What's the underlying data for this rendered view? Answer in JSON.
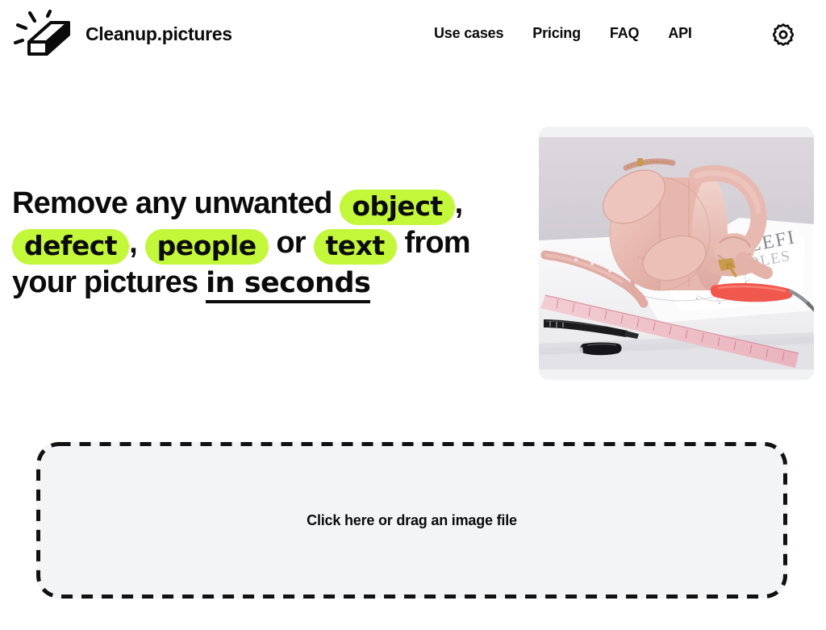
{
  "brand": {
    "name": "Cleanup.pictures",
    "logo_icon": "eraser-sparkle-icon"
  },
  "nav": {
    "items": [
      {
        "label": "Use cases",
        "name": "use-cases"
      },
      {
        "label": "Pricing",
        "name": "pricing"
      },
      {
        "label": "FAQ",
        "name": "faq"
      },
      {
        "label": "API",
        "name": "api"
      }
    ],
    "settings_icon": "gear-icon"
  },
  "hero": {
    "headline": {
      "part1": "Remove any unwanted ",
      "hl_object": "object",
      "comma1": ",",
      "hl_defect": "defect",
      "comma2": ", ",
      "hl_people": "people",
      "or": " or ",
      "hl_text": "text",
      "part2": " from your pictures ",
      "emphasis": "in seconds"
    },
    "image": {
      "alt": "pink leather handbag on a desk with ruler, pens and pattern paper",
      "caption_in_photo": "YUZEFI"
    }
  },
  "dropzone": {
    "label": "Click here or drag an image file"
  },
  "colors": {
    "highlight": "#C2F73A",
    "text": "#0b0b0b",
    "dropzone_fill": "#F2F4F6",
    "dropzone_border": "#111111",
    "image_card_bg": "#F1F2F4"
  }
}
